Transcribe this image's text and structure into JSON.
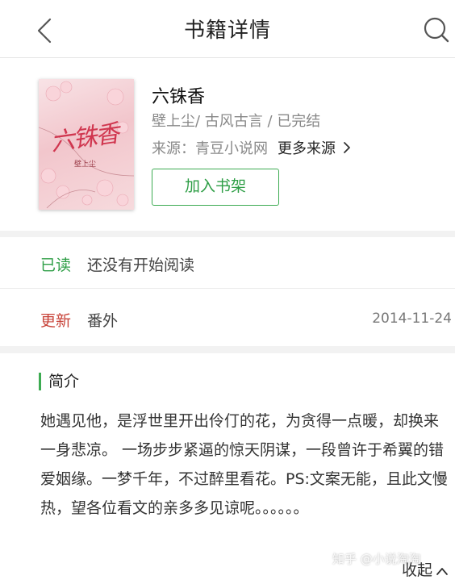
{
  "header": {
    "title": "书籍详情"
  },
  "book": {
    "title": "六铢香",
    "meta": "壁上尘/ 古风古言 / 已完结",
    "source_label": "来源：青豆小说网",
    "more_sources": "更多来源",
    "add_to_shelf": "加入书架",
    "cover_title": "六铢香",
    "cover_author": "壁上尘"
  },
  "read_status": {
    "label": "已读",
    "text": "还没有开始阅读",
    "label_color": "#2e9e46"
  },
  "update": {
    "label": "更新",
    "text": "番外",
    "date": "2014-11-24",
    "label_color": "#c8443a"
  },
  "intro": {
    "heading": "简介",
    "text": "她遇见他，是浮世里开出伶仃的花，为贪得一点暖，却换来一身悲凉。 一场步步紧逼的惊天阴谋，一段曾许于希翼的错爱姻缘。一梦千年，不过醉里看花。PS:文案无能，且此文慢热，望各位看文的亲多多见谅呢。。。。。。",
    "collapse": "收起"
  },
  "watermark": "知乎 @小说淘淘",
  "icons": {
    "back": "back-arrow-icon",
    "search": "search-icon",
    "more": "chevron-right-icon",
    "collapse": "chevron-up-icon"
  },
  "colors": {
    "accent": "#3dab52"
  }
}
